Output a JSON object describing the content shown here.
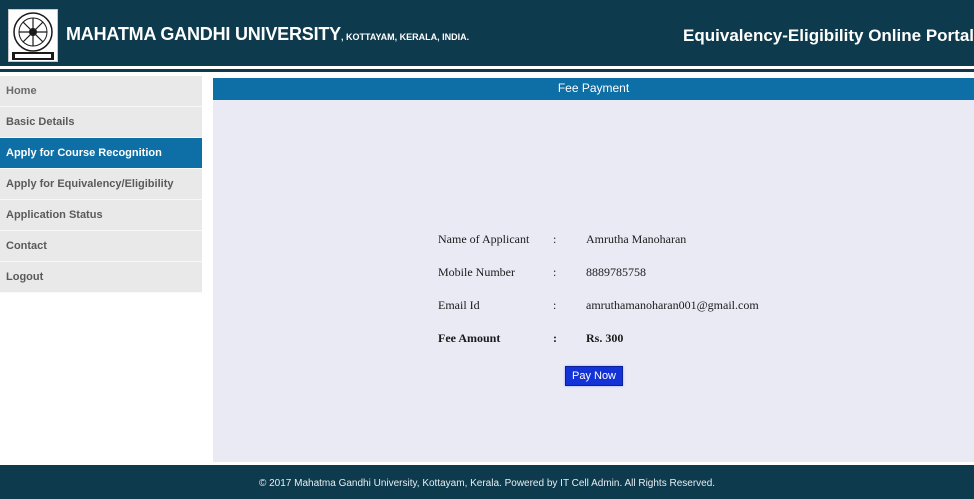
{
  "header": {
    "university_name": "MAHATMA GANDHI UNIVERSITY",
    "university_location": ", KOTTAYAM, KERALA, INDIA.",
    "logo_icon": "university-emblem-icon",
    "portal_title": "Equivalency-Eligibility Online Portal"
  },
  "sidebar": {
    "items": [
      {
        "label": "Home"
      },
      {
        "label": "Basic Details"
      },
      {
        "label": "Apply for Course Recognition"
      },
      {
        "label": "Apply for Equivalency/Eligibility"
      },
      {
        "label": "Application Status"
      },
      {
        "label": "Contact"
      },
      {
        "label": "Logout"
      }
    ],
    "active_index": 2
  },
  "main": {
    "title": "Fee Payment",
    "fields": [
      {
        "label": "Name of Applicant",
        "separator": ":",
        "value": "Amrutha Manoharan"
      },
      {
        "label": "Mobile Number",
        "separator": ":",
        "value": "8889785758"
      },
      {
        "label": "Email Id",
        "separator": ":",
        "value": "amruthamanoharan001@gmail.com"
      },
      {
        "label": "Fee Amount",
        "separator": ":",
        "value": "Rs. 300"
      }
    ],
    "pay_button": "Pay Now"
  },
  "footer": {
    "text": "© 2017 Mahatma Gandhi University, Kottayam, Kerala. Powered by IT Cell Admin. All Rights Reserved."
  },
  "colors": {
    "header_bg": "#0d3a4c",
    "accent_blue": "#0e6fa6",
    "panel_bg": "#eaeaf5",
    "button_bg": "#1433d6"
  }
}
